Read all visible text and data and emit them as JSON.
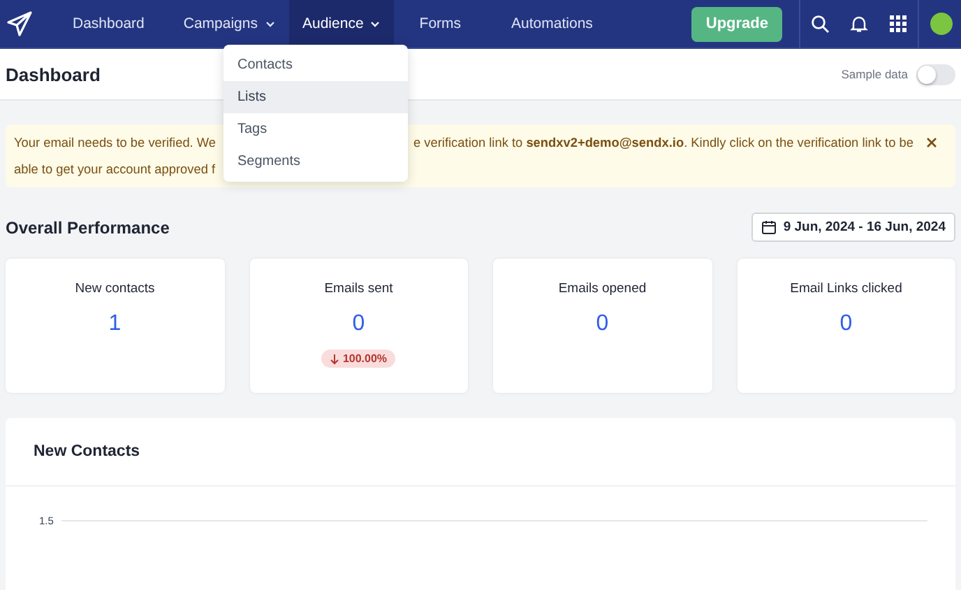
{
  "nav": {
    "items": [
      {
        "label": "Dashboard",
        "dropdown": false,
        "selected": false
      },
      {
        "label": "Campaigns",
        "dropdown": true,
        "selected": false
      },
      {
        "label": "Audience",
        "dropdown": true,
        "selected": true
      },
      {
        "label": "Forms",
        "dropdown": false,
        "selected": false
      },
      {
        "label": "Automations",
        "dropdown": false,
        "selected": false
      }
    ],
    "upgrade_button": "Upgrade"
  },
  "dropdown_menu": {
    "items": [
      {
        "label": "Contacts",
        "selected": false
      },
      {
        "label": "Lists",
        "selected": true
      },
      {
        "label": "Tags",
        "selected": false
      },
      {
        "label": "Segments",
        "selected": false
      }
    ]
  },
  "header": {
    "title": "Dashboard",
    "sample_data": {
      "label": "Sample data",
      "on": false
    }
  },
  "banner": {
    "line_1_left": "Your email needs to be verified. We",
    "line_1_right": "e verification link to **sendxv2+demo@sendx.io**. Kindly click on the verification link to be",
    "line_2_left": "able to get your account approved f"
  },
  "performance": {
    "title": "Overall Performance",
    "date_range": "9 Jun, 2024 - 16 Jun, 2024",
    "cards": [
      {
        "label": "New contacts",
        "value": "1"
      },
      {
        "label": "Emails sent",
        "value": "0",
        "change": "100.00%"
      },
      {
        "label": "Emails opened",
        "value": "0"
      },
      {
        "label": "Email Links clicked",
        "value": "0"
      }
    ]
  },
  "new_contacts": {
    "title": "New Contacts",
    "y_tick_label": "1.5"
  }
}
